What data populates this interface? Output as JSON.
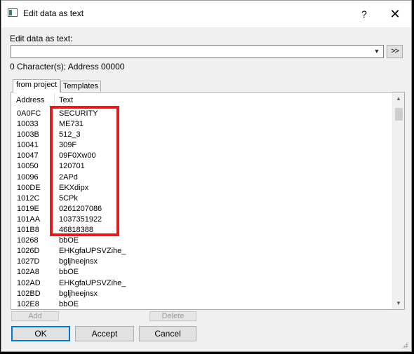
{
  "window": {
    "title": "Edit data as text",
    "help_label": "?",
    "close_label": "✕"
  },
  "edit": {
    "label": "Edit data as text:",
    "value": "",
    "go_label": ">>",
    "status": "0 Character(s); Address 00000"
  },
  "tabs": [
    {
      "label": "from project",
      "active": true
    },
    {
      "label": "Templates",
      "active": false
    }
  ],
  "table": {
    "columns": [
      "Address",
      "Text"
    ],
    "rows": [
      {
        "address": "0A0FC",
        "text": "SECURITY"
      },
      {
        "address": "10033",
        "text": "ME731"
      },
      {
        "address": "1003B",
        "text": "512_3"
      },
      {
        "address": "10041",
        "text": "309F"
      },
      {
        "address": "10047",
        "text": "09F0Xw00"
      },
      {
        "address": "10050",
        "text": "120701"
      },
      {
        "address": "10096",
        "text": "2APd"
      },
      {
        "address": "100DE",
        "text": "EKXdipx"
      },
      {
        "address": "1012C",
        "text": "5CPk"
      },
      {
        "address": "1019E",
        "text": "0261207086"
      },
      {
        "address": "101AA",
        "text": "1037351922"
      },
      {
        "address": "101B8",
        "text": "46818388"
      },
      {
        "address": "10268",
        "text": "bbOE"
      },
      {
        "address": "1026D",
        "text": "EHKgfaUPSVZihe_"
      },
      {
        "address": "1027D",
        "text": "bgljheejnsx"
      },
      {
        "address": "102A8",
        "text": "bbOE"
      },
      {
        "address": "102AD",
        "text": "EHKgfaUPSVZihe_"
      },
      {
        "address": "102BD",
        "text": "bgljheejnsx"
      },
      {
        "address": "102E8",
        "text": "bbOE"
      }
    ]
  },
  "buttons": {
    "add": "Add",
    "delete": "Delete",
    "ok": "OK",
    "accept": "Accept",
    "cancel": "Cancel"
  },
  "colors": {
    "highlight": "#e11b22",
    "focus": "#0078d7"
  }
}
